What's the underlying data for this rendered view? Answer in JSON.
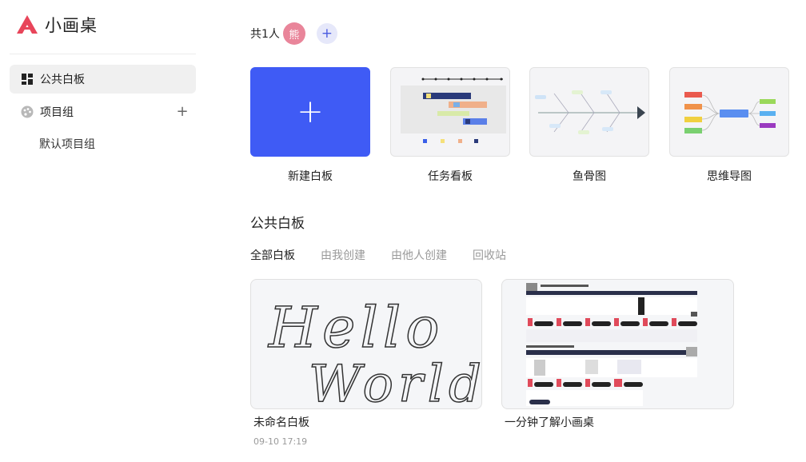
{
  "app": {
    "name": "小画桌",
    "brand_color": "#e8455a",
    "accent_color": "#3f5bf5"
  },
  "sidebar": {
    "public_board": {
      "label": "公共白板",
      "icon": "dashboard-icon"
    },
    "project_group": {
      "label": "项目组",
      "icon": "palette-icon",
      "add_icon": "plus-icon"
    },
    "default_group": {
      "label": "默认项目组"
    }
  },
  "members": {
    "count_label": "共1人",
    "avatar_text": "熊",
    "add_icon": "plus-icon"
  },
  "templates": [
    {
      "label": "新建白板"
    },
    {
      "label": "任务看板"
    },
    {
      "label": "鱼骨图"
    },
    {
      "label": "思维导图"
    }
  ],
  "section": {
    "title": "公共白板",
    "tabs": [
      {
        "label": "全部白板",
        "active": true
      },
      {
        "label": "由我创建",
        "active": false
      },
      {
        "label": "由他人创建",
        "active": false
      },
      {
        "label": "回收站",
        "active": false
      }
    ]
  },
  "boards": [
    {
      "name": "未命名白板",
      "time": "09-10 17:19",
      "thumb_text_1": "Hello",
      "thumb_text_2": "World"
    },
    {
      "name": "一分钟了解小画桌",
      "time": ""
    }
  ]
}
